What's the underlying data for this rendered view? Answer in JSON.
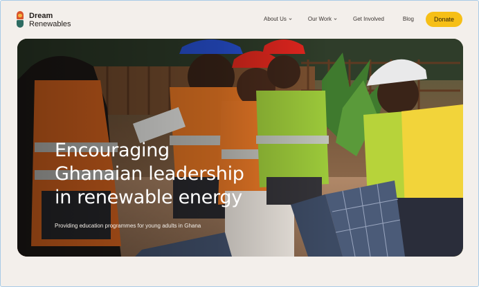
{
  "brand": {
    "name_line1": "Dream",
    "name_line2": "Renewables",
    "logo_icon": "flame-drop-logo",
    "colors": {
      "orange": "#d9542b",
      "yellow": "#f4b63f",
      "green": "#2d6b61"
    }
  },
  "nav": {
    "items": [
      {
        "label": "About Us",
        "has_dropdown": true
      },
      {
        "label": "Our Work",
        "has_dropdown": true
      },
      {
        "label": "Get Involved",
        "has_dropdown": false
      },
      {
        "label": "Blog",
        "has_dropdown": false
      }
    ],
    "donate_label": "Donate",
    "donate_color": "#f6bf16"
  },
  "hero": {
    "title": "Encouraging\nGhanaian leadership\nin renewable energy",
    "subtitle": "Providing education programmes for young adults in Ghana"
  },
  "theme": {
    "background": "#f3efeb"
  }
}
